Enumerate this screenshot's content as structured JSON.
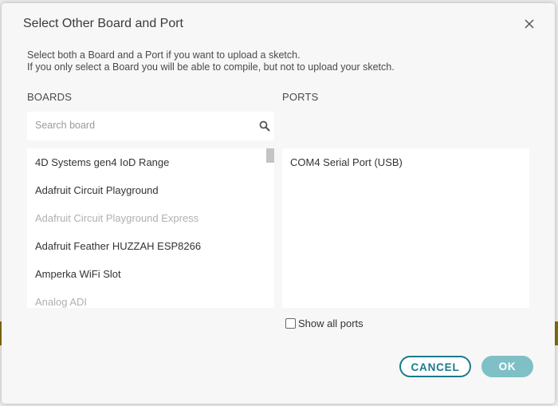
{
  "dialog": {
    "title": "Select Other Board and Port",
    "description_line1": "Select both a Board and a Port if you want to upload a sketch.",
    "description_line2": "If you only select a Board you will be able to compile, but not to upload your sketch."
  },
  "boards": {
    "label": "BOARDS",
    "search_placeholder": "Search board",
    "items": [
      {
        "label": "4D Systems gen4 IoD Range",
        "disabled": false
      },
      {
        "label": "Adafruit Circuit Playground",
        "disabled": false
      },
      {
        "label": "Adafruit Circuit Playground Express",
        "disabled": true
      },
      {
        "label": "Adafruit Feather HUZZAH ESP8266",
        "disabled": false
      },
      {
        "label": "Amperka WiFi Slot",
        "disabled": false
      },
      {
        "label": "Analog ADI",
        "disabled": true
      }
    ]
  },
  "ports": {
    "label": "PORTS",
    "items": [
      {
        "label": "COM4 Serial Port (USB)"
      }
    ],
    "show_all_label": "Show all ports",
    "show_all_checked": false
  },
  "buttons": {
    "cancel": "CANCEL",
    "ok": "OK"
  },
  "colors": {
    "accent": "#1a7a8a",
    "ok_disabled": "#7fc0c6",
    "disabled_text": "#b0b0b0"
  },
  "icons": {
    "close": "close-icon",
    "search": "search-icon"
  }
}
